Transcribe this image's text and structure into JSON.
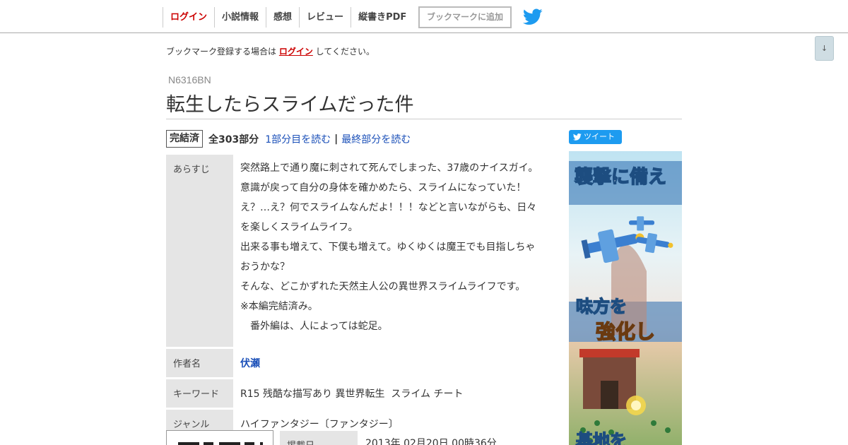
{
  "nav": {
    "items": [
      "ログイン",
      "小説情報",
      "感想",
      "レビュー",
      "縦書きPDF"
    ],
    "bookmark_button": "ブックマークに追加",
    "scroll_button": "↓"
  },
  "login_note": {
    "before": "ブックマーク登録する場合は ",
    "link": "ログイン",
    "after": " してください。"
  },
  "novel": {
    "ncode": "N6316BN",
    "title": "転生したらスライムだった件",
    "status_badge": "完結済",
    "total_parts": "全303部分",
    "read_first": "1部分目を読む",
    "separator": "|",
    "read_last": "最終部分を読む"
  },
  "tweet_button": "ツイート",
  "info": {
    "synopsis_label": "あらすじ",
    "synopsis_lines": [
      "突然路上で通り魔に刺されて死んでしまった、37歳のナイスガイ。",
      "意識が戻って自分の身体を確かめたら、スライムになっていた！",
      "え？…え？何でスライムなんだよ！！！などと言いながらも、日々",
      "を楽しくスライムライフ。",
      "出来る事も増えて、下僕も増えて。ゆくゆくは魔王でも目指しちゃ",
      "おうかな？",
      "そんな、どこかずれた天然主人公の異世界スライムライフです。",
      "※本編完結済み。",
      "　番外編は、人によっては蛇足。"
    ],
    "author_label": "作者名",
    "author": "伏瀬",
    "keyword_label": "キーワード",
    "keywords": "R15 残酷な描写あり 異世界転生  スライム チート",
    "genre_label": "ジャンル",
    "genre": "ハイファンタジー〔ファンタジー〕",
    "published_label": "掲載日",
    "published": "2013年 02月20日 00時36分"
  },
  "ad": {
    "text_top": "襲撃に備え",
    "text_mid_a": "味方を",
    "text_mid_b": "強化し",
    "text_bottom": "基地を"
  },
  "colors": {
    "login_red": "#cc0000",
    "link_blue": "#1a4fb8",
    "twitter_blue": "#1d9bf0",
    "label_bg": "#e5e5e5"
  }
}
